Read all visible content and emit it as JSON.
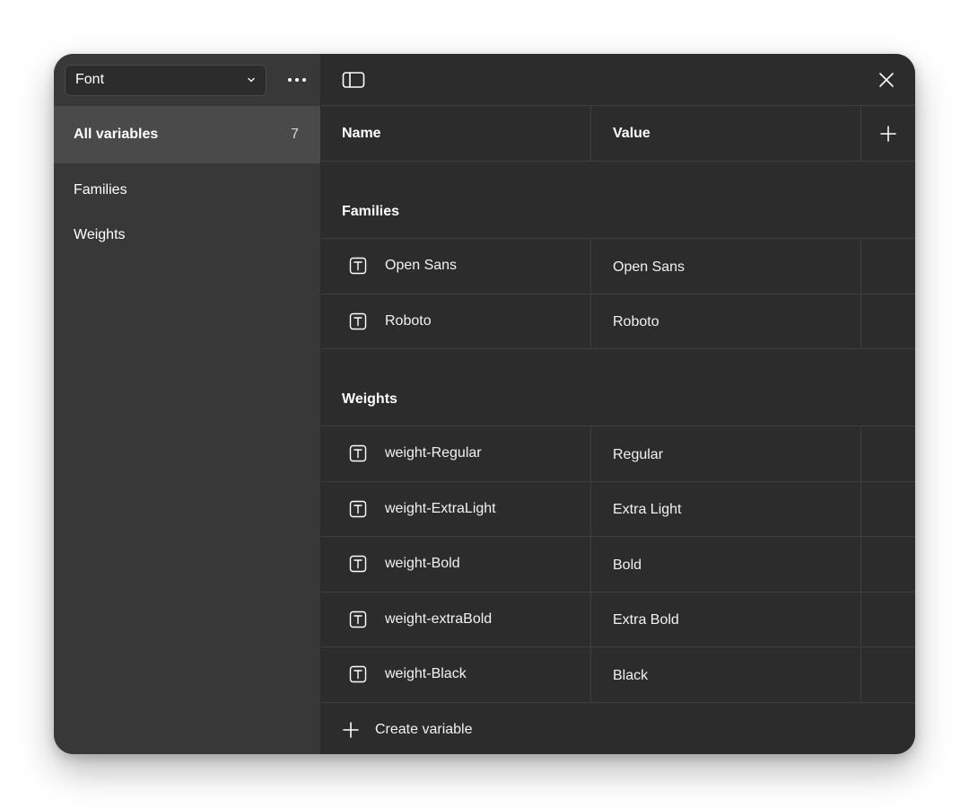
{
  "sidebar": {
    "collection_select": "Font",
    "all_variables": {
      "label": "All variables",
      "count": "7"
    },
    "groups": [
      "Families",
      "Weights"
    ]
  },
  "table": {
    "headers": {
      "name": "Name",
      "value": "Value"
    },
    "sections": [
      {
        "title": "Families",
        "rows": [
          {
            "name": "Open Sans",
            "value": "Open Sans"
          },
          {
            "name": "Roboto",
            "value": "Roboto"
          }
        ]
      },
      {
        "title": "Weights",
        "rows": [
          {
            "name": "weight-Regular",
            "value": "Regular"
          },
          {
            "name": "weight-ExtraLight",
            "value": "Extra Light"
          },
          {
            "name": "weight-Bold",
            "value": "Bold"
          },
          {
            "name": "weight-extraBold",
            "value": "Extra Bold"
          },
          {
            "name": "weight-Black",
            "value": "Black"
          }
        ]
      }
    ],
    "create_label": "Create variable"
  },
  "icons": {
    "more": "more-horizontal-icon",
    "sidebar_toggle": "sidebar-panel-icon",
    "close": "close-icon",
    "add": "plus-icon",
    "variable_type": "text-type-icon"
  },
  "colors": {
    "window_bg": "#2c2c2c",
    "sidebar_bg": "#383838",
    "selected_bg": "#4a4a4a",
    "divider": "#3e3e3e",
    "text": "#ffffff"
  }
}
